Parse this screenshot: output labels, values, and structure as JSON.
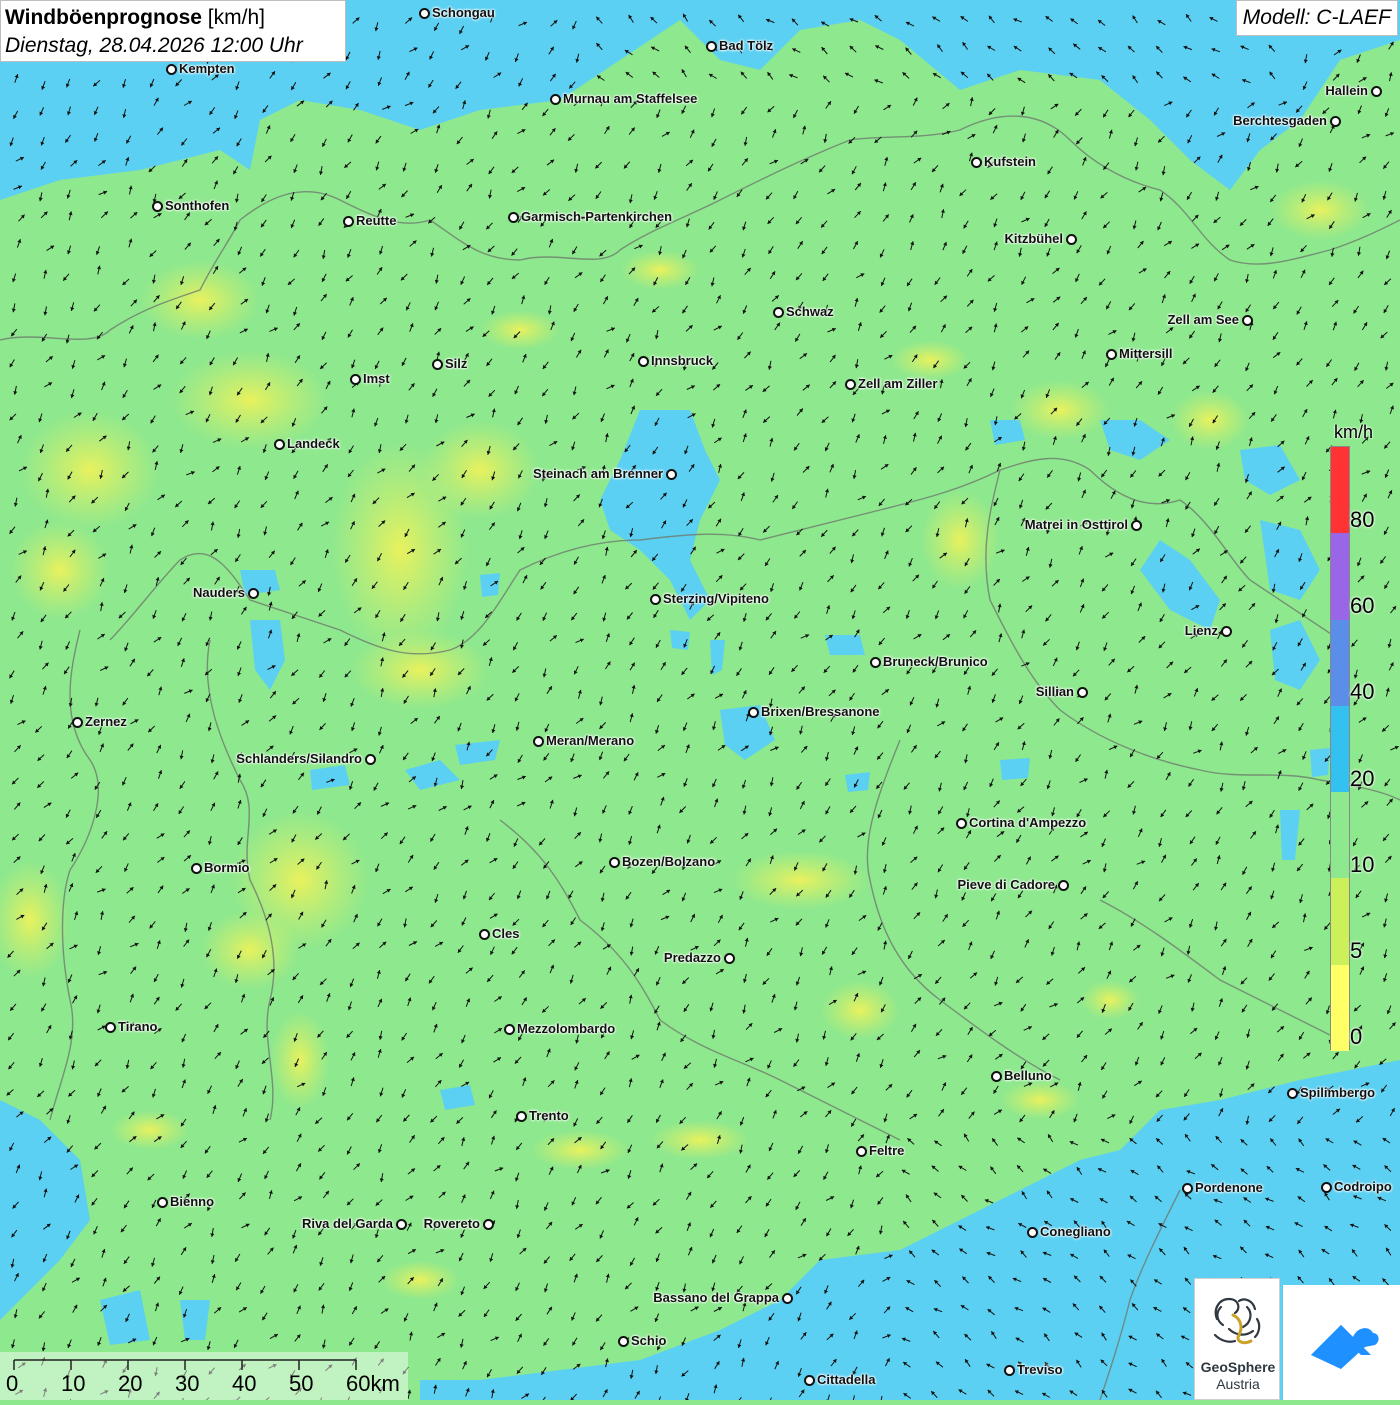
{
  "header": {
    "title_bold": "Windböenprognose",
    "title_unit": " [km/h]",
    "subtitle": "Dienstag, 28.04.2026 12:00 Uhr",
    "model": "Modell: C-LAEF"
  },
  "legend": {
    "unit": "km/h",
    "classes": [
      {
        "from": 0,
        "to": 5,
        "color": "#ffff66"
      },
      {
        "from": 5,
        "to": 10,
        "color": "#ccf05a"
      },
      {
        "from": 10,
        "to": 20,
        "color": "#8ee88e"
      },
      {
        "from": 20,
        "to": 40,
        "color": "#33c2f0"
      },
      {
        "from": 40,
        "to": 60,
        "color": "#5b8ee8"
      },
      {
        "from": 60,
        "to": 80,
        "color": "#9966e8"
      },
      {
        "from": 80,
        "to": 100,
        "color": "#ff3333"
      }
    ],
    "labels": [
      "80",
      "60",
      "40",
      "20",
      "10",
      "5",
      "0"
    ]
  },
  "scalebar": {
    "labels": [
      "0",
      "10",
      "20",
      "30",
      "40",
      "50",
      "60km"
    ]
  },
  "cities": [
    "Schongau",
    "Kempten",
    "Bad Tölz",
    "Hallein",
    "Murnau am Staffelsee",
    "Berchtesgaden",
    "Kufstein",
    "Sonthofen",
    "Reutte",
    "Garmisch-Partenkirchen",
    "Kitzbühel",
    "Schwaz",
    "Zell am See",
    "Mittersill",
    "Innsbruck",
    "Silz",
    "Imst",
    "Zell am Ziller",
    "Landeck",
    "Steinach am Brenner",
    "Matrei in Osttirol",
    "Nauders",
    "Sterzing/Vipiteno",
    "Lienz",
    "Bruneck/Brunico",
    "Sillian",
    "Brixen/Bressanone",
    "Zernez",
    "Meran/Merano",
    "Schlanders/Silandro",
    "Cortina d'Ampezzo",
    "Bozen/Bolzano",
    "Bormio",
    "Pieve di Cadore",
    "Cles",
    "Predazzo",
    "Tirano",
    "Mezzolombardo",
    "Belluno",
    "Spilimbergo",
    "Trento",
    "Feltre",
    "Pordenone",
    "Codroipo",
    "Bienno",
    "Riva del Garda",
    "Rovereto",
    "Conegliano",
    "Bassano del Grappa",
    "Schio",
    "Treviso",
    "Cittadella"
  ],
  "logos": {
    "geosphere_line1": "GeoSphere",
    "geosphere_line2": "Austria"
  },
  "icons": {
    "geosphere": "geosphere-austria-logo",
    "second": "cloud-arrow-logo"
  }
}
